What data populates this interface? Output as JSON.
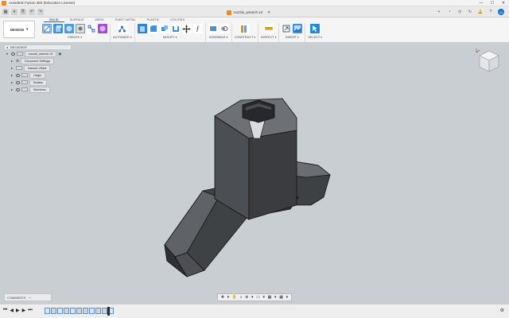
{
  "app": {
    "title": "Autodesk Fusion 360 (Education License)",
    "document_name": "nozzle_wrench v3",
    "close_glyph": "✕",
    "window_controls": [
      "—",
      "☐",
      "✕"
    ]
  },
  "quick_access": [
    "▦",
    "▾",
    "⎘",
    "↶",
    "↷"
  ],
  "right_controls": [
    "+",
    "◔",
    "◷",
    "↻",
    "🔔",
    "?",
    "JD"
  ],
  "ribbon": {
    "workspace": "DESIGN",
    "workspace_arrow": "▾",
    "tabs": [
      "SOLID",
      "SURFACE",
      "MESH",
      "SHEET METAL",
      "PLASTIC",
      "UTILITIES"
    ],
    "active_tab": "SOLID",
    "groups": [
      {
        "label": "CREATE",
        "icons": [
          "sketch-icon",
          "extrude-icon",
          "revolve-icon",
          "hole-icon",
          "pattern-icon",
          "form-icon"
        ]
      },
      {
        "label": "AUTOMATE",
        "icons": [
          "automate-icon"
        ]
      },
      {
        "label": "MODIFY",
        "icons": [
          "press-pull-icon",
          "fillet-icon",
          "combine-icon",
          "shell-icon",
          "move-icon",
          "function-icon"
        ]
      },
      {
        "label": "ASSEMBLE",
        "icons": [
          "joint-icon",
          "rigid-icon"
        ]
      },
      {
        "label": "CONSTRUCT",
        "icons": [
          "plane-icon"
        ]
      },
      {
        "label": "INSPECT",
        "icons": [
          "measure-icon"
        ]
      },
      {
        "label": "INSERT",
        "icons": [
          "insert-icon",
          "image-icon"
        ]
      },
      {
        "label": "SELECT",
        "icons": [
          "select-icon"
        ]
      }
    ],
    "dropdown_arrow": "▾"
  },
  "browser": {
    "header": "BROWSER",
    "header_arrow": "◂",
    "root": "nozzle_wrench v3",
    "items": [
      "Document Settings",
      "Named Views",
      "Origin",
      "Bodies",
      "Sketches"
    ]
  },
  "comments": {
    "label": "COMMENTS",
    "plus": "+"
  },
  "navbar": [
    "✥",
    "▾",
    "✋",
    "⌕",
    "⊕",
    "▾",
    "▭",
    "▾",
    "▦",
    "▾",
    "▦",
    "▾"
  ],
  "timeline": {
    "controls": [
      "⏮",
      "◀",
      "▶",
      "▶",
      "⏭"
    ],
    "steps": [
      "sk",
      "ex",
      "sk",
      "ex",
      "sk",
      "ex",
      "ex",
      "sk",
      "ex",
      "ex",
      "sk"
    ],
    "gear": "⚙"
  },
  "colors": {
    "accent": "#0a6fd0",
    "viewport": "#c9ced2",
    "model_dark": "#3a3c3f",
    "model_light": "#5d6064"
  }
}
